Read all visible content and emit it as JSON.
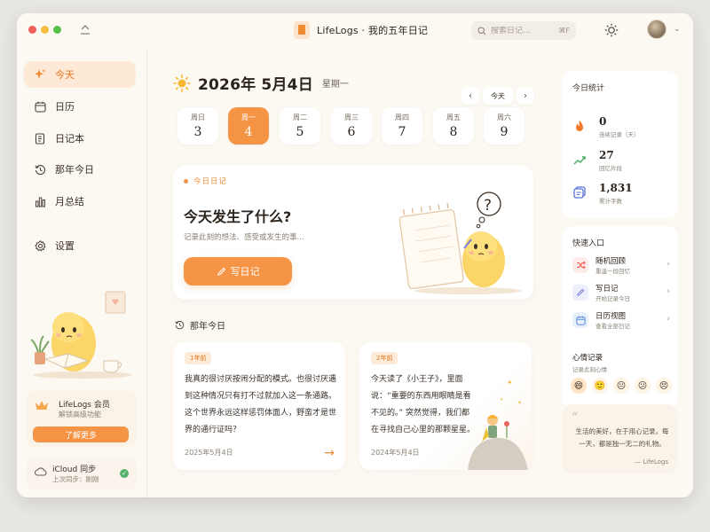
{
  "app": {
    "title": "LifeLogs · 我的五年日记",
    "search_placeholder": "搜索日记...",
    "search_shortcut": "⌘F"
  },
  "sidebar": {
    "items": [
      {
        "label": "今天",
        "icon": "sparkle-icon",
        "active": true
      },
      {
        "label": "日历",
        "icon": "calendar-icon",
        "active": false
      },
      {
        "label": "日记本",
        "icon": "notebook-icon",
        "active": false
      },
      {
        "label": "那年今日",
        "icon": "history-icon",
        "active": false
      },
      {
        "label": "月总结",
        "icon": "bar-chart-icon",
        "active": false
      },
      {
        "label": "设置",
        "icon": "gear-icon",
        "active": false
      }
    ],
    "member": {
      "title": "LifeLogs 会员",
      "subtitle": "解锁高级功能",
      "button": "了解更多"
    },
    "icloud": {
      "title": "iCloud 同步",
      "subtitle": "上次同步：刚刚"
    }
  },
  "main": {
    "date_title": "2026年 5月4日",
    "weekday": "星期一",
    "today_button": "今天",
    "week": [
      {
        "name": "周日",
        "date": "3",
        "active": false
      },
      {
        "name": "周一",
        "date": "4",
        "active": true
      },
      {
        "name": "周二",
        "date": "5",
        "active": false
      },
      {
        "name": "周三",
        "date": "6",
        "active": false
      },
      {
        "name": "周四",
        "date": "7",
        "active": false
      },
      {
        "name": "周五",
        "date": "8",
        "active": false
      },
      {
        "name": "周六",
        "date": "9",
        "active": false
      }
    ],
    "diary": {
      "tag": "今日日记",
      "title": "今天发生了什么?",
      "subtitle": "记录此刻的想法、感受或发生的事...",
      "write_button": "写日记"
    },
    "throwback": {
      "title": "那年今日",
      "cards": [
        {
          "badge": "1年前",
          "text": "我真的很讨厌按闹分配的模式。也很讨厌遇到这种情况只有打不过就加入这一条通路。这个世界永远这样惩罚体面人，野蛮才是世界的通行证吗？",
          "date": "2025年5月4日"
        },
        {
          "badge": "2年前",
          "text": "今天读了《小王子》，里面说：“重要的东西用眼睛是看不见的。” 突然觉得，我们都在寻找自己心里的那颗星星。",
          "date": "2024年5月4日"
        }
      ]
    }
  },
  "right_panel": {
    "stats": {
      "title": "今日统计",
      "items": [
        {
          "value": "0",
          "label": "连续记录（天）",
          "icon": "flame-icon"
        },
        {
          "value": "27",
          "label": "回忆片段",
          "icon": "trend-icon"
        },
        {
          "value": "1,831",
          "label": "累计字数",
          "icon": "document-stack-icon"
        }
      ]
    },
    "quick": {
      "title": "快速入口",
      "items": [
        {
          "title": "随机回顾",
          "subtitle": "重温一段回忆",
          "icon": "shuffle-icon",
          "color": "#f0605a"
        },
        {
          "title": "写日记",
          "subtitle": "开始记录今日",
          "icon": "pen-icon",
          "color": "#7a7fd6"
        },
        {
          "title": "日历视图",
          "subtitle": "查看全部日记",
          "icon": "calendar-icon",
          "color": "#5a8de0"
        }
      ]
    },
    "mood": {
      "title": "心情记录",
      "subtitle": "记录此刻心情",
      "moods": [
        "😄",
        "🙂",
        "😐",
        "😕",
        "😣"
      ]
    },
    "quote": {
      "text": "生活的美好，在于用心记录。每一天，都是独一无二的礼物。",
      "author": "— LifeLogs"
    }
  },
  "colors": {
    "accent": "#f59444",
    "background": "#fcf8f2",
    "active_nav": "#fde9d6"
  }
}
